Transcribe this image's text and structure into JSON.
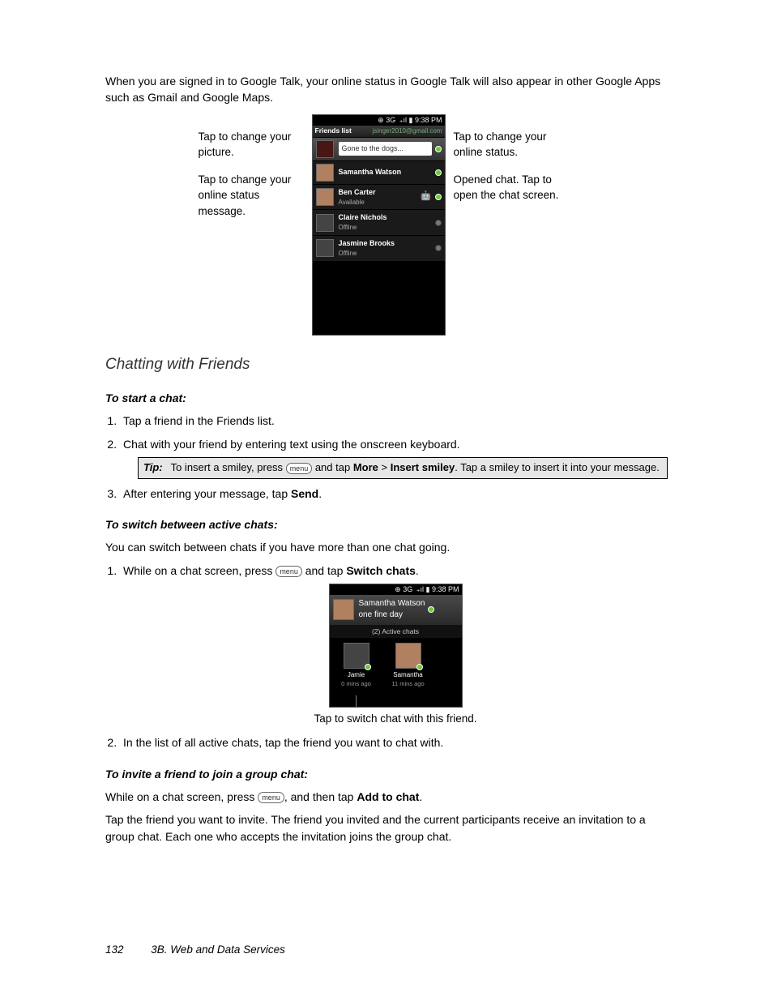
{
  "intro": "When you are signed in to Google Talk, your online status in Google Talk will also appear in other Google Apps such as Gmail and Google Maps.",
  "callouts": {
    "left1": "Tap to change your picture.",
    "left2": "Tap to change your online status message.",
    "right1": "Tap to change your online status.",
    "right2": "Opened chat. Tap to open the chat screen."
  },
  "phone1": {
    "time": "9:38 PM",
    "signal_label": "3G",
    "header_title": "Friends list",
    "header_email": "jsinger2010@gmail.com",
    "status_input": "Gone to the dogs...",
    "friends": [
      {
        "name": "Samantha  Watson",
        "sub": "",
        "status": "green",
        "avatar": "face"
      },
      {
        "name": "Ben Carter",
        "sub": "Available",
        "status": "green",
        "avatar": "face"
      },
      {
        "name": "Claire Nichols",
        "sub": "Offline",
        "status": "gray",
        "avatar": ""
      },
      {
        "name": "Jasmine Brooks",
        "sub": "Offline",
        "status": "gray",
        "avatar": ""
      }
    ]
  },
  "section_title": "Chatting with Friends",
  "sub1": "To start a chat:",
  "list1": {
    "i1": "Tap a friend in the Friends list.",
    "i2": "Chat with your friend by entering text using the onscreen keyboard.",
    "i3_a": "After entering your message, tap ",
    "i3_b": "Send",
    "i3_c": "."
  },
  "tip": {
    "label": "Tip:",
    "a": "To insert a smiley, press ",
    "menu": "menu",
    "b": " and tap ",
    "more": "More",
    "gt": " > ",
    "ins": "Insert smiley",
    "c": ". Tap a smiley to insert it into your message."
  },
  "sub2": "To switch between active chats:",
  "para2": "You can switch between chats if you have more than one chat going.",
  "list2": {
    "i1_a": "While on a chat screen, press ",
    "i1_b": " and tap ",
    "i1_c": "Switch chats",
    "i1_d": ".",
    "i2": "In the list of all active chats, tap the friend you want to chat with."
  },
  "phone2": {
    "time": "9:38 PM",
    "signal_label": "3G",
    "top_name": "Samantha  Watson",
    "top_sub": "one fine day",
    "active_label": "(2) Active chats",
    "chats": [
      {
        "name": "Jamie",
        "time": "0 mins ago",
        "avatar": ""
      },
      {
        "name": "Samantha",
        "time": "11 mins ago",
        "avatar": "face"
      }
    ]
  },
  "caption2": "Tap to switch chat with this friend.",
  "sub3": "To invite a friend to join a group chat:",
  "para3_a": "While on a chat screen, press ",
  "para3_b": ", and then tap ",
  "para3_c": "Add to chat",
  "para3_d": ".",
  "para4": "Tap the friend you want to invite. The friend you invited and the current participants receive an invitation to a group chat. Each one who accepts the invitation joins the group chat.",
  "footer": {
    "page": "132",
    "chapter": "3B. Web and Data Services"
  }
}
